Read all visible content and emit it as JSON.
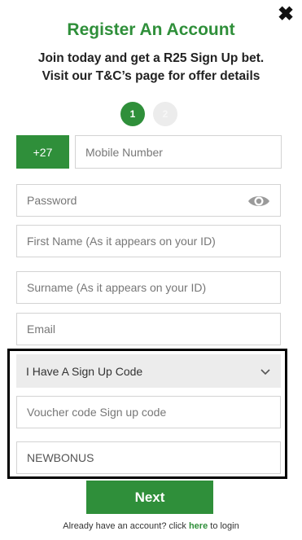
{
  "close": {
    "symbol": "✖"
  },
  "header": {
    "title": "Register An Account",
    "subtitle_line1": "Join today and get a R25 Sign Up bet.",
    "subtitle_line2": "Visit our T&C’s page for offer details"
  },
  "steps": [
    {
      "label": "1",
      "active": true
    },
    {
      "label": "2",
      "active": false
    }
  ],
  "form": {
    "country_code": "+27",
    "mobile_placeholder": "Mobile Number",
    "password_placeholder": "Password",
    "first_name_placeholder": "First Name (As it appears on your ID)",
    "surname_placeholder": "Surname (As it appears on your ID)",
    "email_placeholder": "Email",
    "signup_code_select": "I Have A Sign Up Code",
    "voucher_placeholder": "Voucher code Sign up code",
    "voucher_value": "NEWBONUS"
  },
  "actions": {
    "next_label": "Next",
    "login_prefix": "Already have an account? click ",
    "login_link": "here",
    "login_suffix": " to login"
  },
  "icons": {
    "password_toggle": "eye-icon",
    "dropdown": "chevron-down-icon",
    "close": "close-icon"
  },
  "colors": {
    "brand_green": "#2f8f3a",
    "select_bg": "#ececec",
    "highlight_border": "#000000"
  }
}
